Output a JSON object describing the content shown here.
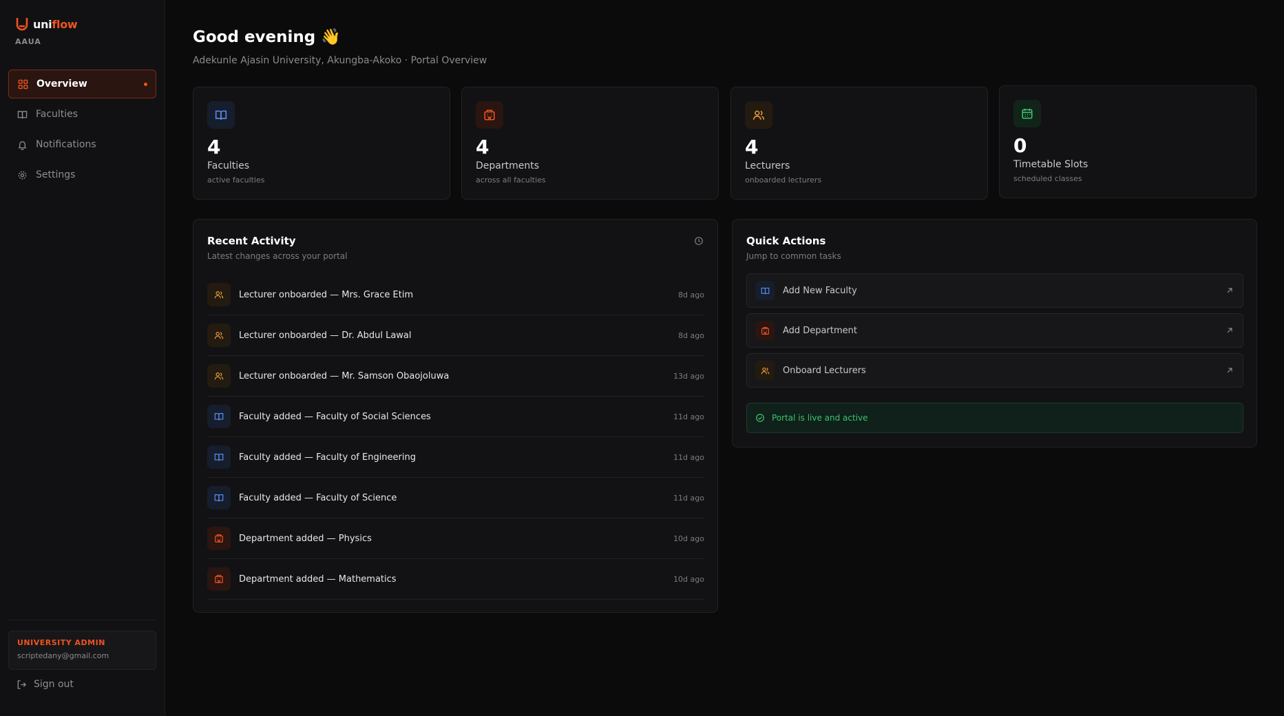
{
  "brand": {
    "name_a": "uni",
    "name_b": "flow",
    "subtitle": "AAUA"
  },
  "nav": [
    {
      "label": "Overview",
      "icon": "grid-icon"
    },
    {
      "label": "Faculties",
      "icon": "book-icon"
    },
    {
      "label": "Notifications",
      "icon": "bell-icon"
    },
    {
      "label": "Settings",
      "icon": "gear-icon"
    }
  ],
  "user": {
    "role": "UNIVERSITY ADMIN",
    "email": "scriptedany@gmail.com",
    "signout": "Sign out"
  },
  "header": {
    "greeting": "Good evening 👋",
    "subtitle": "Adekunle Ajasin University, Akungba-Akoko · Portal Overview"
  },
  "stats": [
    {
      "value": "4",
      "label": "Faculties",
      "sub": "active faculties",
      "icon": "book-icon",
      "color": "#5b8def"
    },
    {
      "value": "4",
      "label": "Departments",
      "sub": "across all faculties",
      "icon": "building-icon",
      "color": "#f0531f"
    },
    {
      "value": "4",
      "label": "Lecturers",
      "sub": "onboarded lecturers",
      "icon": "users-icon",
      "color": "#e89a3c"
    },
    {
      "value": "0",
      "label": "Timetable Slots",
      "sub": "scheduled classes",
      "icon": "calendar-icon",
      "color": "#3ec46d"
    }
  ],
  "activity": {
    "title": "Recent Activity",
    "subtitle": "Latest changes across your portal",
    "items": [
      {
        "text": "Lecturer onboarded — Mrs. Grace Etim",
        "time": "8d ago",
        "kind": "lecturer"
      },
      {
        "text": "Lecturer onboarded — Dr. Abdul Lawal",
        "time": "8d ago",
        "kind": "lecturer"
      },
      {
        "text": "Lecturer onboarded — Mr. Samson Obaojoluwa",
        "time": "13d ago",
        "kind": "lecturer"
      },
      {
        "text": "Faculty added — Faculty of Social Sciences",
        "time": "11d ago",
        "kind": "faculty"
      },
      {
        "text": "Faculty added — Faculty of Engineering",
        "time": "11d ago",
        "kind": "faculty"
      },
      {
        "text": "Faculty added — Faculty of Science",
        "time": "11d ago",
        "kind": "faculty"
      },
      {
        "text": "Department added — Physics",
        "time": "10d ago",
        "kind": "department"
      },
      {
        "text": "Department added — Mathematics",
        "time": "10d ago",
        "kind": "department"
      }
    ]
  },
  "quick_actions": {
    "title": "Quick Actions",
    "subtitle": "Jump to common tasks",
    "items": [
      {
        "label": "Add New Faculty",
        "kind": "faculty"
      },
      {
        "label": "Add Department",
        "kind": "department"
      },
      {
        "label": "Onboard Lecturers",
        "kind": "lecturer"
      }
    ],
    "status": "Portal is live and active"
  }
}
